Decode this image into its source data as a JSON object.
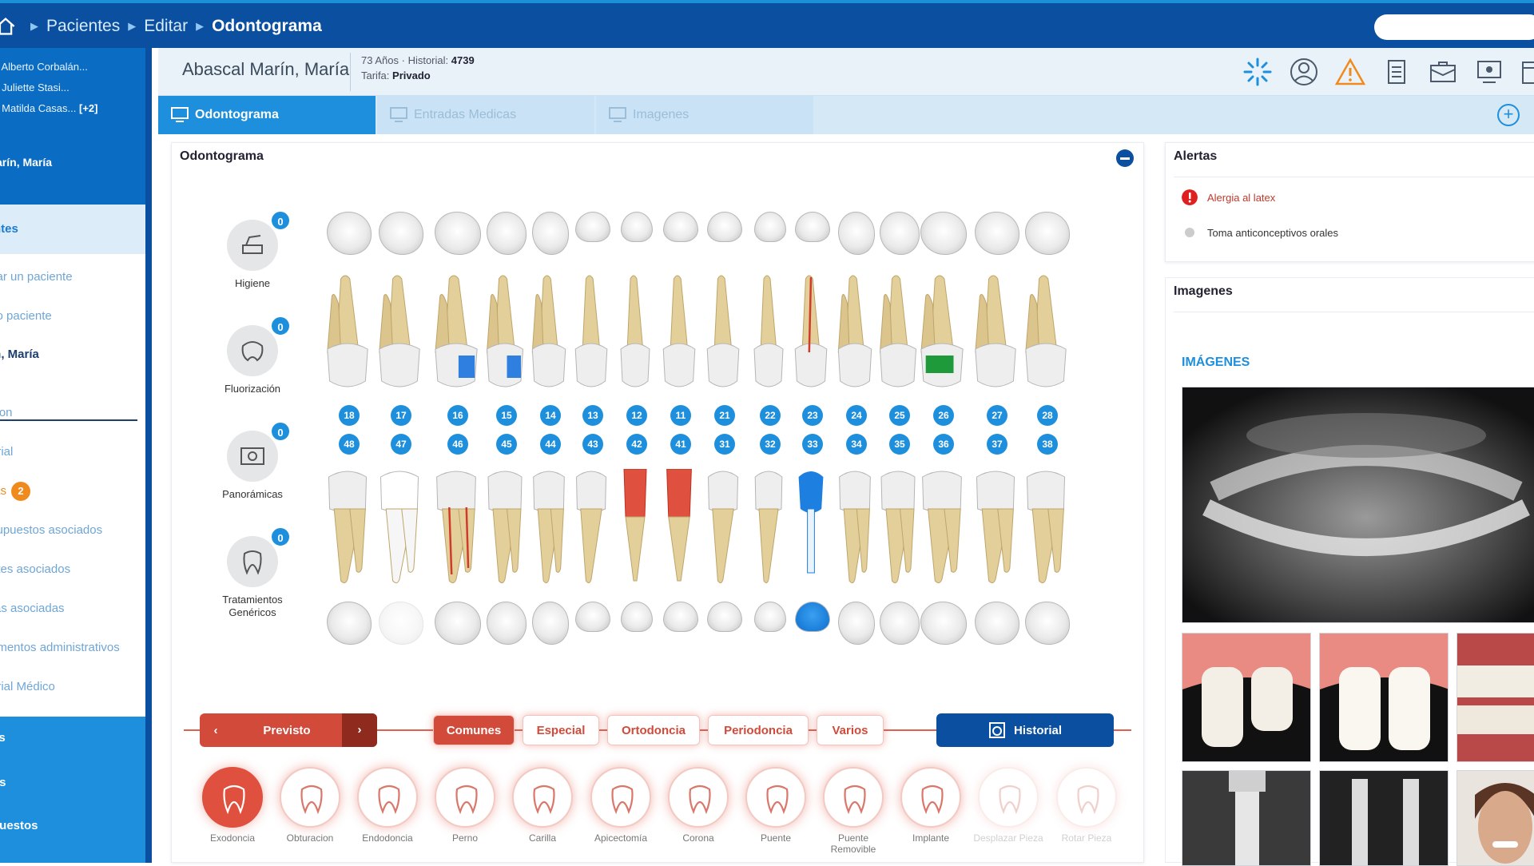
{
  "breadcrumb": {
    "items": [
      "Pacientes",
      "Editar",
      "Odontograma"
    ]
  },
  "sidebar": {
    "recent": [
      "Alberto Corbalán...",
      "Juliette Stasi...",
      "Matilda Casas..."
    ],
    "recent_more": "[+2]",
    "patient": "cal Marín, María",
    "section": "ntes",
    "items": [
      "car un paciente",
      "vo paciente",
      "ín, María",
      "cion",
      "orial",
      "tas",
      "supuestos asociados",
      "ntes asociados",
      "ras asociadas",
      "umentos administrativos",
      "orial Médico"
    ],
    "alert_badge": "2",
    "footer": [
      "es",
      "os",
      "puestos"
    ]
  },
  "patient_header": {
    "name": "Abascal Marín, María",
    "age": "73 Años",
    "historial_label": "· Historial:",
    "historial": "4739",
    "tarifa_label": "Tarifa:",
    "tarifa": "Privado",
    "icons": [
      "loading-icon",
      "user-circle-icon",
      "warning-icon",
      "documents-icon",
      "medical-kit-icon",
      "screen-icon",
      "calendar-icon"
    ]
  },
  "tabs": {
    "items": [
      "Odontograma",
      "Entradas Medicas",
      "Imagenes"
    ],
    "active": "Odontograma"
  },
  "odontogram": {
    "title": "Odontograma",
    "categories": [
      {
        "label": "Higiene",
        "count": "0",
        "icon": "hygiene-icon"
      },
      {
        "label": "Fluorización",
        "count": "0",
        "icon": "fluor-icon"
      },
      {
        "label": "Panorámicas",
        "count": "0",
        "icon": "xray-icon"
      },
      {
        "label": "Tratamientos Genéricos",
        "count": "0",
        "icon": "tooth-icon"
      }
    ],
    "upper_numbers": [
      "18",
      "17",
      "16",
      "15",
      "14",
      "13",
      "12",
      "11",
      "21",
      "22",
      "23",
      "24",
      "25",
      "26",
      "27",
      "28"
    ],
    "lower_numbers": [
      "48",
      "47",
      "46",
      "45",
      "44",
      "43",
      "42",
      "41",
      "31",
      "32",
      "33",
      "34",
      "35",
      "36",
      "37",
      "38"
    ],
    "treatment_bar": {
      "plan": "Previsto",
      "categories": [
        "Comunes",
        "Especial",
        "Ortodoncia",
        "Periodoncia",
        "Varios"
      ],
      "active_category": "Comunes",
      "history": "Historial"
    },
    "tools": [
      {
        "label": "Exodoncia"
      },
      {
        "label": "Obturacion"
      },
      {
        "label": "Endodoncia"
      },
      {
        "label": "Perno"
      },
      {
        "label": "Carilla"
      },
      {
        "label": "Apicectomía"
      },
      {
        "label": "Corona"
      },
      {
        "label": "Puente"
      },
      {
        "label": "Puente Removible"
      },
      {
        "label": "Implante"
      },
      {
        "label": "Desplazar Pieza"
      },
      {
        "label": "Rotar Pieza"
      }
    ]
  },
  "alerts": {
    "title": "Alertas",
    "items": [
      {
        "text": "Alergia al latex",
        "level": "high",
        "color": "#e02020"
      },
      {
        "text": "Toma anticonceptivos orales",
        "level": "low",
        "color": "#cccccc"
      }
    ]
  },
  "images": {
    "title": "Imagenes",
    "label": "IMÁGENES"
  },
  "colors": {
    "brand_dark": "#0a4fa0",
    "brand": "#1d8fdc",
    "accent_red": "#d24a3a"
  }
}
